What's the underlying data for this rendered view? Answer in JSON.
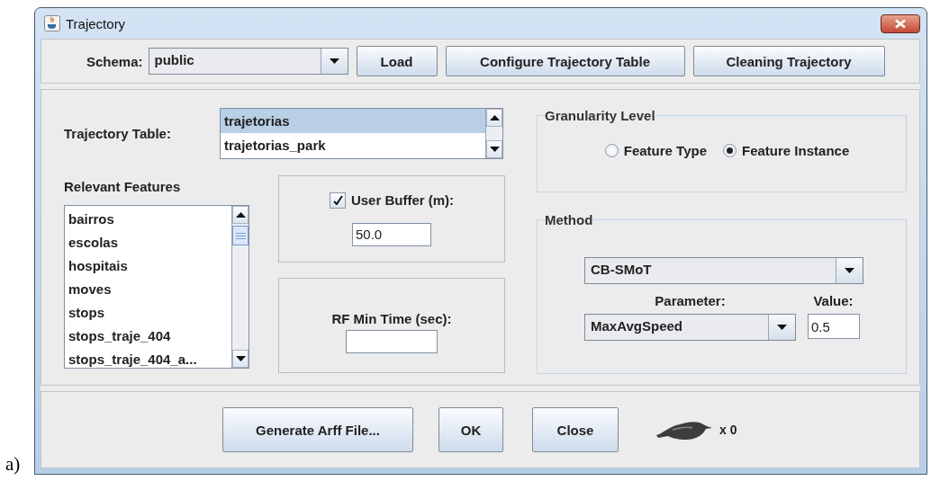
{
  "window": {
    "title": "Trajectory"
  },
  "toolbar": {
    "schema_label": "Schema:",
    "schema_value": "public",
    "buttons": [
      "Load",
      "Configure Trajectory Table",
      "Cleaning Trajectory"
    ]
  },
  "trajectory_table": {
    "label": "Trajectory Table:",
    "items": [
      {
        "label": "trajetorias",
        "selected": true
      },
      {
        "label": "trajetorias_park",
        "selected": false
      }
    ]
  },
  "relevant_features": {
    "label": "Relevant Features",
    "items": [
      {
        "label": "bairros",
        "selected": false
      },
      {
        "label": "escolas",
        "selected": false
      },
      {
        "label": "hospitais",
        "selected": false
      },
      {
        "label": "moves",
        "selected": false
      },
      {
        "label": "stops",
        "selected": false
      },
      {
        "label": "stops_traje_404",
        "selected": false
      },
      {
        "label": "stops_traje_404_a...",
        "selected": false
      }
    ]
  },
  "user_buffer": {
    "label": "User Buffer (m):",
    "checked": true,
    "value": "50.0"
  },
  "rf_min_time": {
    "label": "RF Min Time (sec):"
  },
  "granularity": {
    "title": "Granularity Level",
    "options": [
      {
        "label": "Feature Type",
        "selected": false
      },
      {
        "label": "Feature Instance",
        "selected": true
      }
    ]
  },
  "method": {
    "title": "Method",
    "algorithm": "CB-SMoT",
    "parameter_label": "Parameter:",
    "value_label": "Value:",
    "parameter": "MaxAvgSpeed",
    "value": "0.5"
  },
  "footer": {
    "buttons": [
      "Generate Arff File...",
      "OK",
      "Close"
    ],
    "counter": "x 0"
  },
  "caption": "a)"
}
